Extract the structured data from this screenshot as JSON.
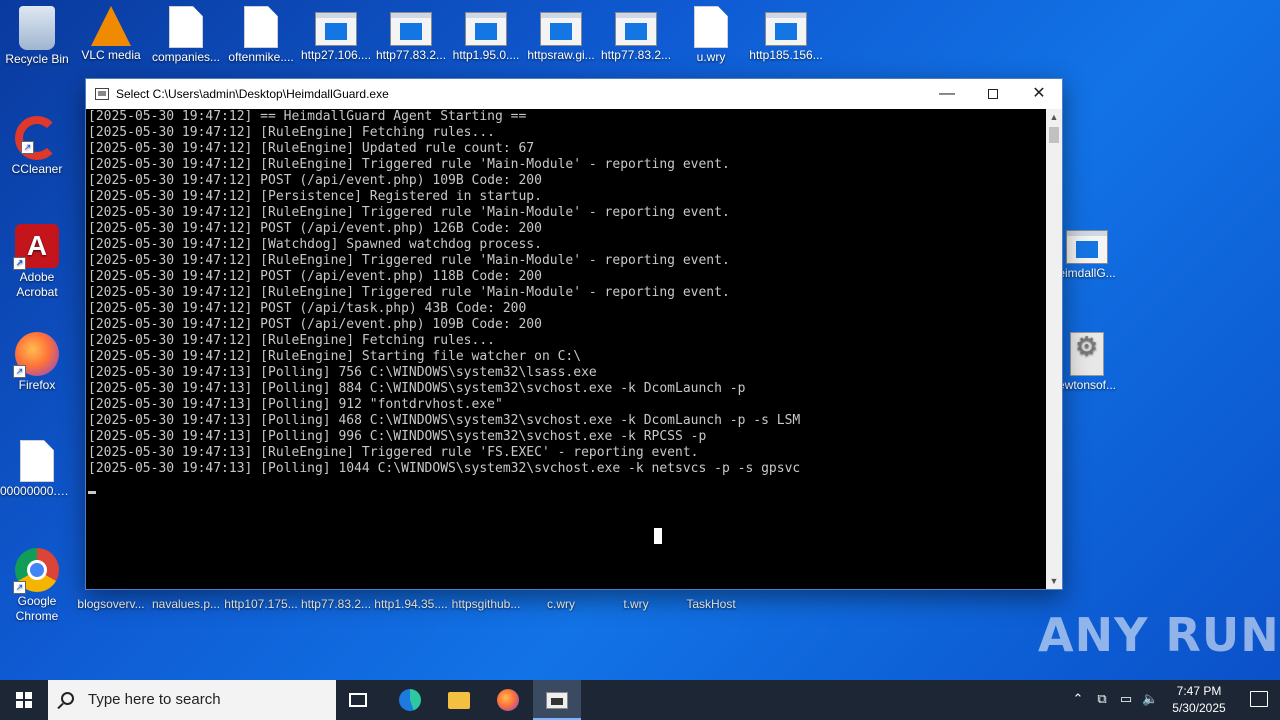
{
  "desktop": {
    "icons_top": [
      {
        "label": "Recycle Bin"
      },
      {
        "label": "VLC media"
      },
      {
        "label": "companies..."
      },
      {
        "label": "oftenmike...."
      },
      {
        "label": "http27.106...."
      },
      {
        "label": "http77.83.2..."
      },
      {
        "label": "http1.95.0...."
      },
      {
        "label": "httpsraw.gi..."
      },
      {
        "label": "http77.83.2..."
      },
      {
        "label": "u.wry"
      },
      {
        "label": "http185.156..."
      }
    ],
    "icons_left": [
      {
        "label": "CCleaner"
      },
      {
        "label": "Adobe Acrobat"
      },
      {
        "label": "Firefox"
      },
      {
        "label": "00000000.eky"
      },
      {
        "label": "Google Chrome"
      }
    ],
    "icons_right": [
      {
        "label": "eimdallG..."
      },
      {
        "label": "ewtonsof..."
      }
    ],
    "icons_bottom": [
      {
        "label": "blogsoverv..."
      },
      {
        "label": "navalues.p..."
      },
      {
        "label": "http107.175..."
      },
      {
        "label": "http77.83.2..."
      },
      {
        "label": "http1.94.35...."
      },
      {
        "label": "httpsgithub..."
      },
      {
        "label": "c.wry"
      },
      {
        "label": "t.wry"
      },
      {
        "label": "TaskHost"
      }
    ],
    "watermark": "ANY RUN"
  },
  "console": {
    "title": "Select C:\\Users\\admin\\Desktop\\HeimdallGuard.exe",
    "lines": [
      "[2025-05-30 19:47:12] == HeimdallGuard Agent Starting ==",
      "[2025-05-30 19:47:12] [RuleEngine] Fetching rules...",
      "[2025-05-30 19:47:12] [RuleEngine] Updated rule count: 67",
      "[2025-05-30 19:47:12] [RuleEngine] Triggered rule 'Main-Module' - reporting event.",
      "[2025-05-30 19:47:12] POST (/api/event.php) 109B Code: 200",
      "[2025-05-30 19:47:12] [Persistence] Registered in startup.",
      "[2025-05-30 19:47:12] [RuleEngine] Triggered rule 'Main-Module' - reporting event.",
      "[2025-05-30 19:47:12] POST (/api/event.php) 126B Code: 200",
      "[2025-05-30 19:47:12] [Watchdog] Spawned watchdog process.",
      "[2025-05-30 19:47:12] [RuleEngine] Triggered rule 'Main-Module' - reporting event.",
      "[2025-05-30 19:47:12] POST (/api/event.php) 118B Code: 200",
      "[2025-05-30 19:47:12] [RuleEngine] Triggered rule 'Main-Module' - reporting event.",
      "[2025-05-30 19:47:12] POST (/api/task.php) 43B Code: 200",
      "[2025-05-30 19:47:12] POST (/api/event.php) 109B Code: 200",
      "[2025-05-30 19:47:12] [RuleEngine] Fetching rules...",
      "[2025-05-30 19:47:12] [RuleEngine] Starting file watcher on C:\\",
      "[2025-05-30 19:47:13] [Polling] 756 C:\\WINDOWS\\system32\\lsass.exe",
      "[2025-05-30 19:47:13] [Polling] 884 C:\\WINDOWS\\system32\\svchost.exe -k DcomLaunch -p",
      "[2025-05-30 19:47:13] [Polling] 912 \"fontdrvhost.exe\"",
      "[2025-05-30 19:47:13] [Polling] 468 C:\\WINDOWS\\system32\\svchost.exe -k DcomLaunch -p -s LSM",
      "[2025-05-30 19:47:13] [Polling] 996 C:\\WINDOWS\\system32\\svchost.exe -k RPCSS -p",
      "[2025-05-30 19:47:13] [RuleEngine] Triggered rule 'FS.EXEC' - reporting event.",
      "[2025-05-30 19:47:13] [Polling] 1044 C:\\WINDOWS\\system32\\svchost.exe -k netsvcs -p -s gpsvc"
    ]
  },
  "taskbar": {
    "search_placeholder": "Type here to search",
    "time": "7:47 PM",
    "date": "5/30/2025"
  }
}
